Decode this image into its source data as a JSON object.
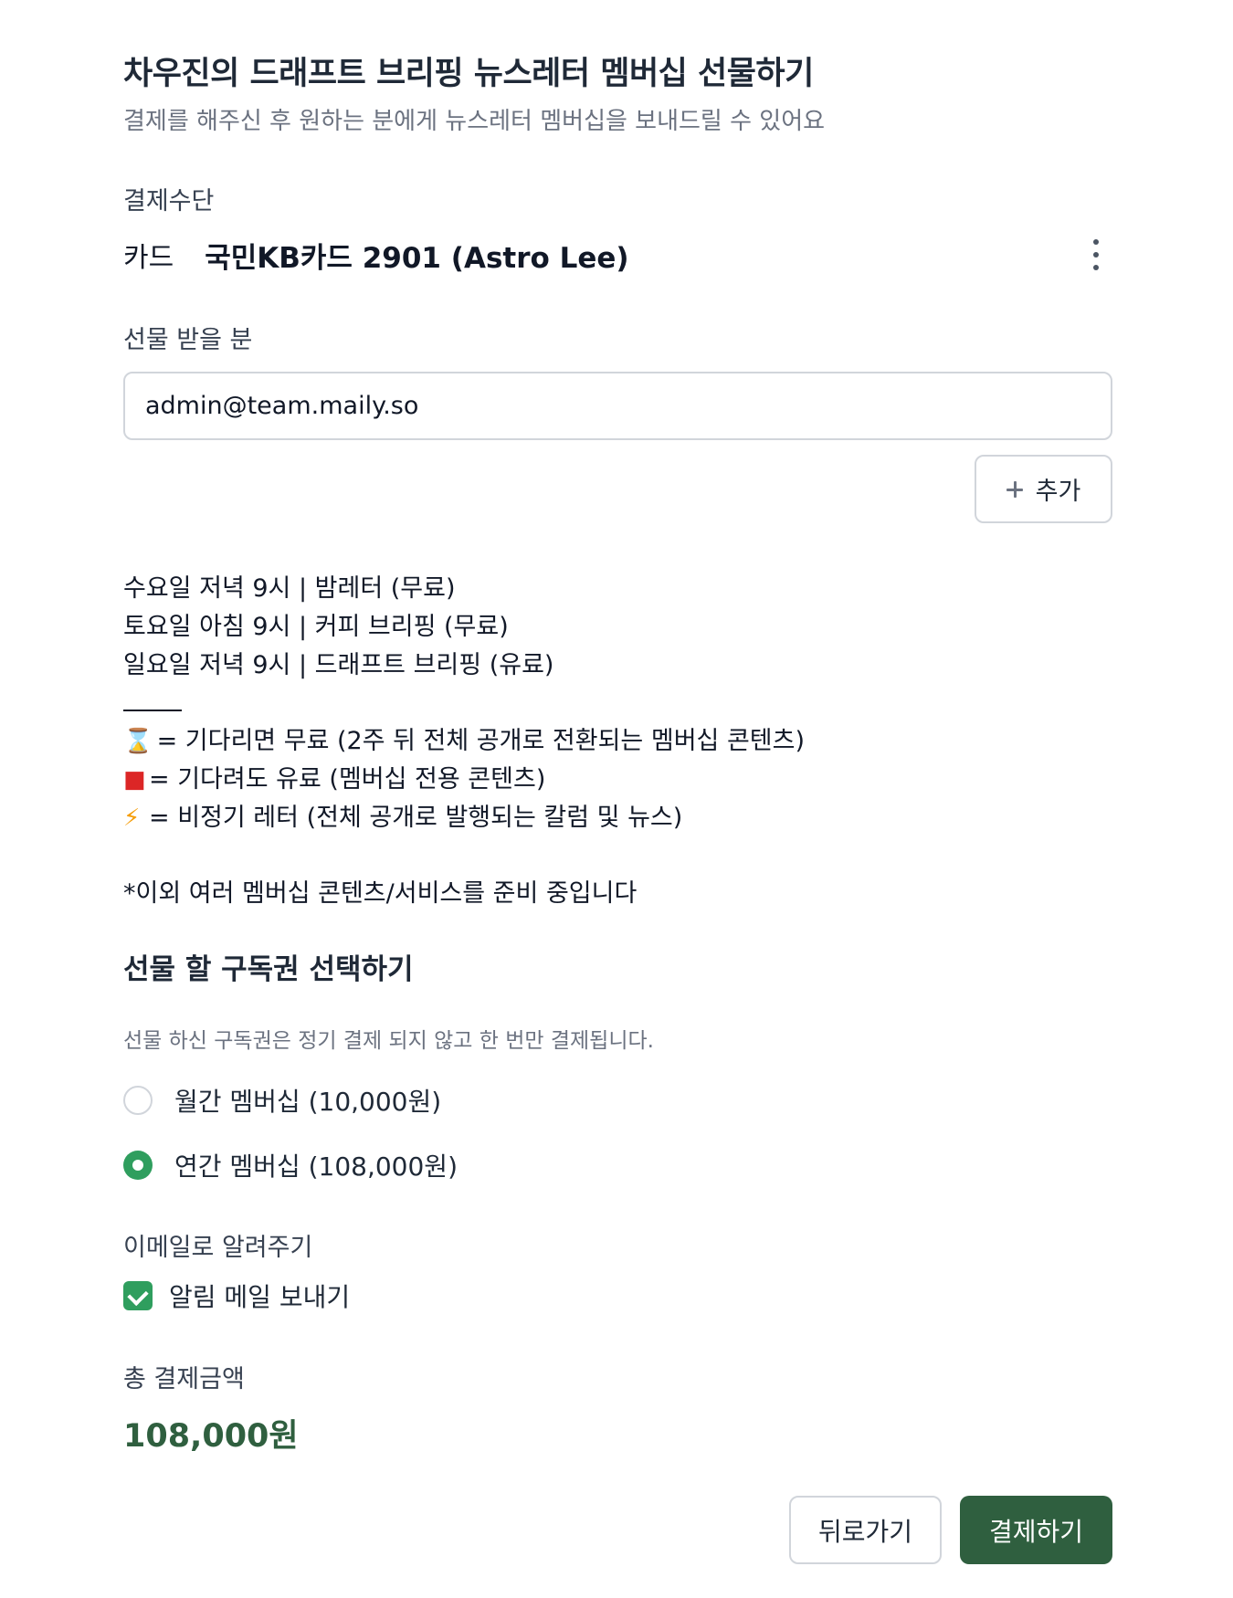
{
  "header": {
    "title": "차우진의 드래프트 브리핑 뉴스레터 멤버십 선물하기",
    "subtitle": "결제를 해주신 후 원하는 분에게 뉴스레터 멤버십을 보내드릴 수 있어요"
  },
  "payment_method": {
    "label": "결제수단",
    "type": "카드",
    "card": "국민KB카드 2901 (Astro Lee)",
    "menu_icon": "kebab-menu-icon"
  },
  "recipient": {
    "label": "선물 받을 분",
    "email_value": "admin@team.maily.so",
    "add_button_label": "추가",
    "add_icon": "plus-icon"
  },
  "description": {
    "schedule": [
      "수요일 저녁 9시 | 밤레터 (무료)",
      "토요일 아침 9시 | 커피 브리핑 (무료)",
      "일요일 저녁 9시 | 드래프트 브리핑 (유료)"
    ],
    "legend": [
      {
        "icon": "hourglass-icon",
        "glyph": "⌛",
        "text": " = 기다리면 무료 (2주 뒤 전체 공개로 전환되는 멤버십 콘텐츠)"
      },
      {
        "icon": "gift-icon",
        "glyph": "■",
        "text": "= 기다려도 유료 (멤버십 전용 콘텐츠)"
      },
      {
        "icon": "lightning-icon",
        "glyph": "⚡",
        "text": "= 비정기 레터 (전체 공개로 발행되는 칼럼 및 뉴스)"
      }
    ],
    "footnote": "*이외 여러 멤버십 콘텐츠/서비스를 준비 중입니다"
  },
  "subscription": {
    "title": "선물 할 구독권 선택하기",
    "note": "선물 하신 구독권은 정기 결제 되지 않고 한 번만 결제됩니다.",
    "options": [
      {
        "label": "월간 멤버십 (10,000원)",
        "selected": false
      },
      {
        "label": "연간 멤버십 (108,000원)",
        "selected": true
      }
    ]
  },
  "notify": {
    "label": "이메일로 알려주기",
    "checkbox_label": "알림 메일 보내기",
    "checked": true
  },
  "total": {
    "label": "총 결제금액",
    "amount": "108,000원"
  },
  "actions": {
    "back_label": "뒤로가기",
    "pay_label": "결제하기"
  },
  "colors": {
    "accent_green": "#2f9e5e",
    "primary_dark_green": "#2f5f3f",
    "border_gray": "#d1d5db",
    "muted_text": "#6b7280"
  }
}
